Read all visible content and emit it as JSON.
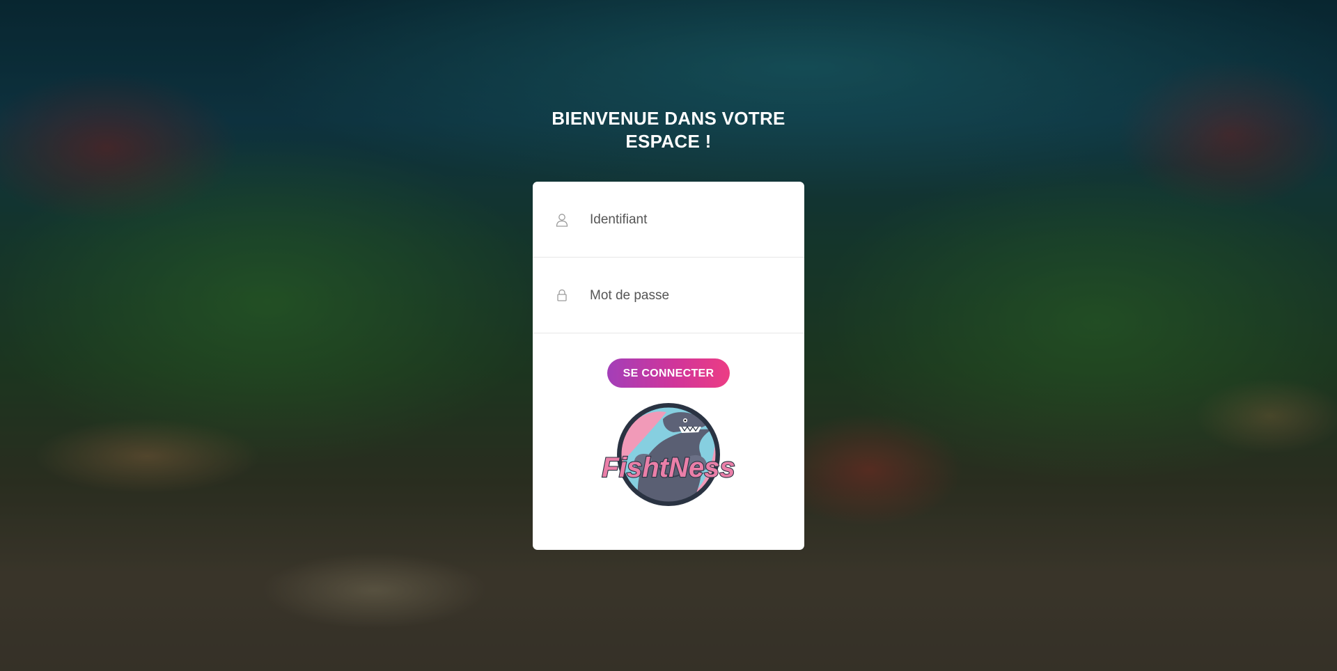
{
  "header": {
    "title_line1": "BIENVENUE DANS VOTRE",
    "title_line2": "ESPACE !"
  },
  "login": {
    "username_placeholder": "Identifiant",
    "password_placeholder": "Mot de passe",
    "submit_label": "SE CONNECTER",
    "username_icon": "user-icon",
    "password_icon": "lock-icon"
  },
  "logo": {
    "text": "FishtNess"
  },
  "colors": {
    "button_start": "#a33fb8",
    "button_end": "#ec3d84",
    "card_bg": "#ffffff",
    "logo_pink": "#ea7fa8",
    "logo_ring": "#2a3342"
  }
}
